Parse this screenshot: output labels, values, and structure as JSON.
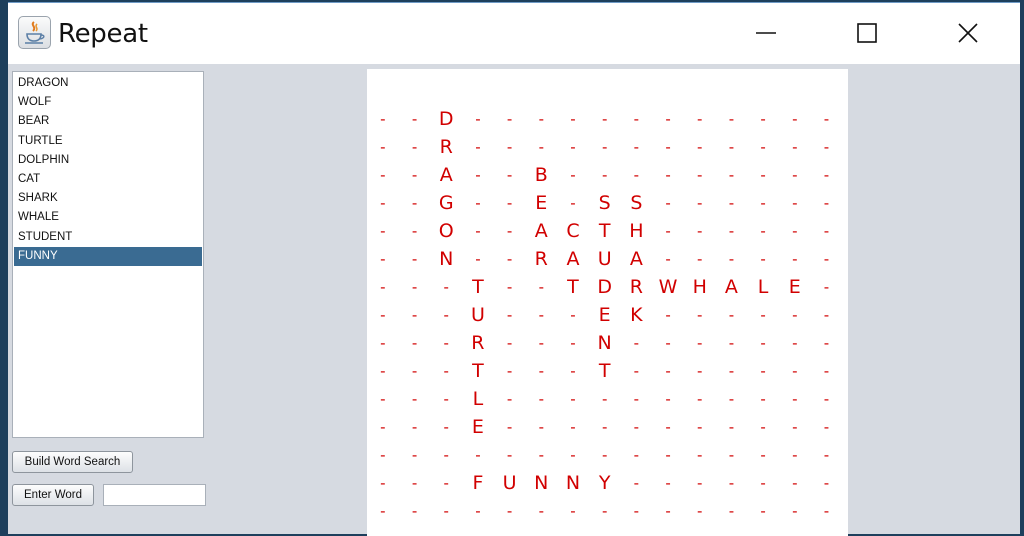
{
  "window": {
    "title": "Repeat",
    "app_icon": "java-coffee-cup-icon",
    "controls": {
      "minimize": "minimize-icon",
      "maximize": "maximize-icon",
      "close": "close-icon"
    }
  },
  "word_list": {
    "items": [
      "DRAGON",
      "WOLF",
      "BEAR",
      "TURTLE",
      "DOLPHIN",
      "CAT",
      "SHARK",
      "WHALE",
      "STUDENT",
      "FUNNY"
    ],
    "selected_index": 9
  },
  "buttons": {
    "build_label": "Build Word Search",
    "enter_label": "Enter Word"
  },
  "word_input": {
    "value": "",
    "placeholder": ""
  },
  "board": {
    "letter_color": "#d10000",
    "empty_symbol": "-",
    "rows": [
      "--D------------",
      "--R------------",
      "--A--B---------",
      "--G--E-SS------",
      "--O--ACTH------",
      "--N--RAUA------",
      "---T--TDRWHALE-",
      "---U---EK------",
      "---R---N-------",
      "---T---T-------",
      "---L-----------",
      "---E-----------",
      "---------------",
      "---FUNNY-------",
      "---------------"
    ]
  },
  "colors": {
    "selection": "#3a6b92",
    "window_background": "#d6dae1"
  }
}
